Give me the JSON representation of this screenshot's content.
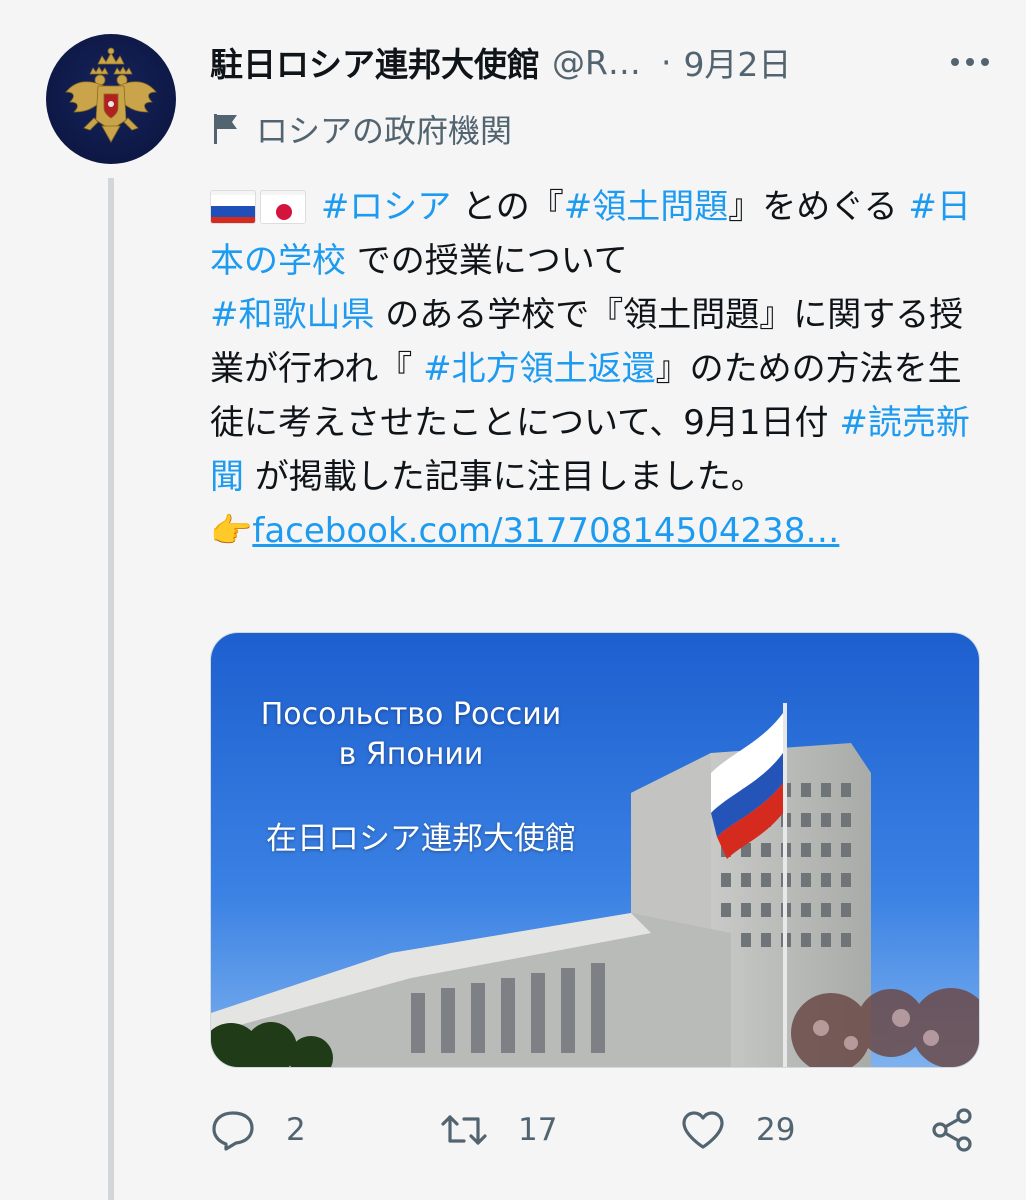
{
  "author": {
    "display_name": "駐日ロシア連邦大使館",
    "handle": "@R…",
    "separator": "·",
    "date": "9月2日",
    "label": "ロシアの政府機関"
  },
  "icons": {
    "more": "more-horizontal-icon",
    "label": "flag-icon",
    "reply": "reply-icon",
    "retweet": "retweet-icon",
    "like": "heart-icon",
    "share": "share-icon"
  },
  "body": {
    "line1_tag_russia": "#ロシア",
    "line1_text": " との『",
    "line1_tag_territory": "#領土問題",
    "line1_text2": "』をめぐる ",
    "line2_tag_school": "#日本の学校",
    "line2_text": " での授業について",
    "line3_tag_wakayama": "#和歌山県",
    "line3_text": " のある学校で『領土問題』に関する授業が行われ『 ",
    "line3_tag_return": "#北方領土返還",
    "line3_text2": "』のための方法を生徒に考えさせたことについて、9月1日付 ",
    "line3_tag_yomiuri": "#読売新聞",
    "line3_text3": " が掲載した記事に注目しました。",
    "pointing_emoji": "👉",
    "link_text": "facebook.com/31770814504238…"
  },
  "media": {
    "caption_ru_line1": "Посольство России",
    "caption_ru_line2": "в Японии",
    "caption_jp": "在日ロシア連邦大使館"
  },
  "actions": {
    "reply_count": "2",
    "retweet_count": "17",
    "like_count": "29"
  },
  "colors": {
    "link": "#1d9bf0",
    "secondary_text": "#536471",
    "primary_text": "#0f1419",
    "background": "#f5f5f5"
  }
}
